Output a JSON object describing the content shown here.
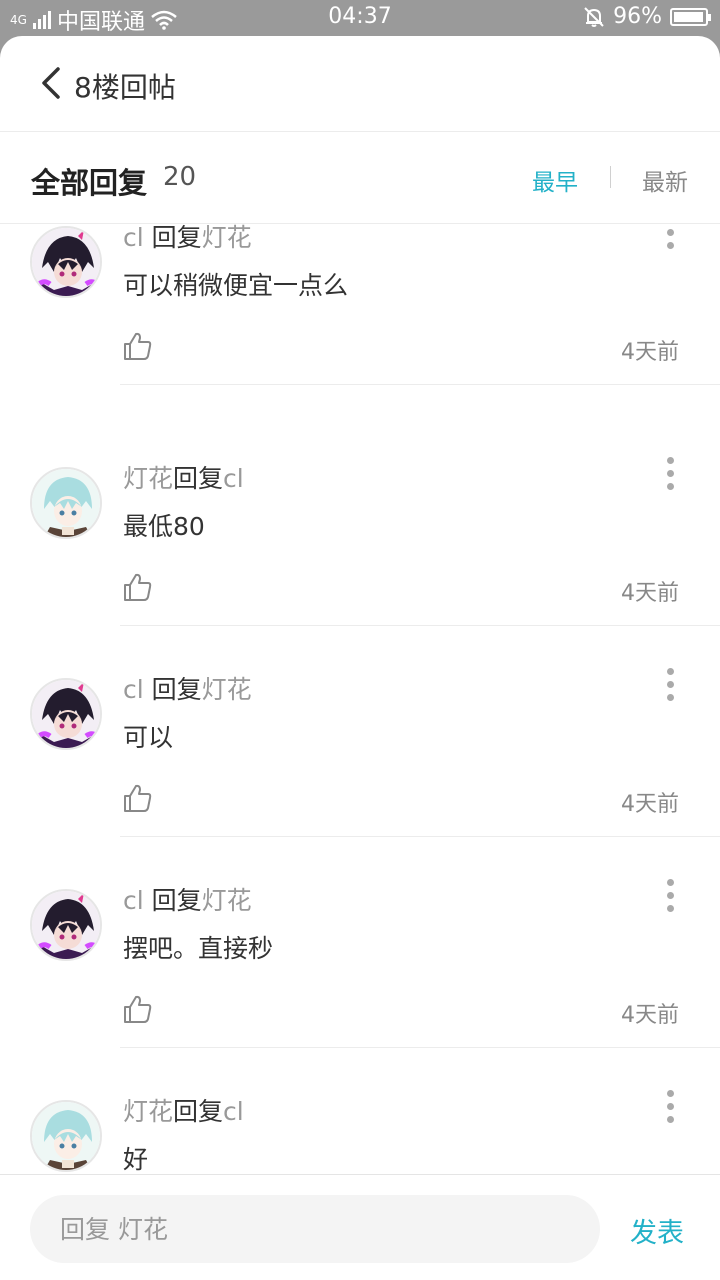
{
  "status_bar": {
    "network": "4G",
    "carrier": "中国联通",
    "time": "04:37",
    "battery": "96%",
    "battery_level": 0.96
  },
  "header": {
    "title": "8楼回帖"
  },
  "sort": {
    "label": "全部回复",
    "count": "20",
    "earliest": "最早",
    "newest": "最新",
    "active": "最早",
    "accent_color": "#23b1c8"
  },
  "comments": [
    {
      "author": "cl",
      "reply_word": "回复",
      "target": "灯花",
      "text": "可以稍微便宜一点么",
      "time": "4天前",
      "avatar": "dark-haired-avatar"
    },
    {
      "author": "灯花",
      "reply_word": "回复",
      "target": "cl",
      "text": "最低80",
      "time": "4天前",
      "avatar": "light-haired-avatar"
    },
    {
      "author": "cl",
      "reply_word": "回复",
      "target": "灯花",
      "text": "可以",
      "time": "4天前",
      "avatar": "dark-haired-avatar"
    },
    {
      "author": "cl",
      "reply_word": "回复",
      "target": "灯花",
      "text": "摆吧。直接秒",
      "time": "4天前",
      "avatar": "dark-haired-avatar"
    },
    {
      "author": "灯花",
      "reply_word": "回复",
      "target": "cl",
      "text": "好",
      "time": "",
      "avatar": "light-haired-avatar"
    }
  ],
  "composer": {
    "placeholder": "回复 灯花",
    "submit_label": "发表"
  }
}
